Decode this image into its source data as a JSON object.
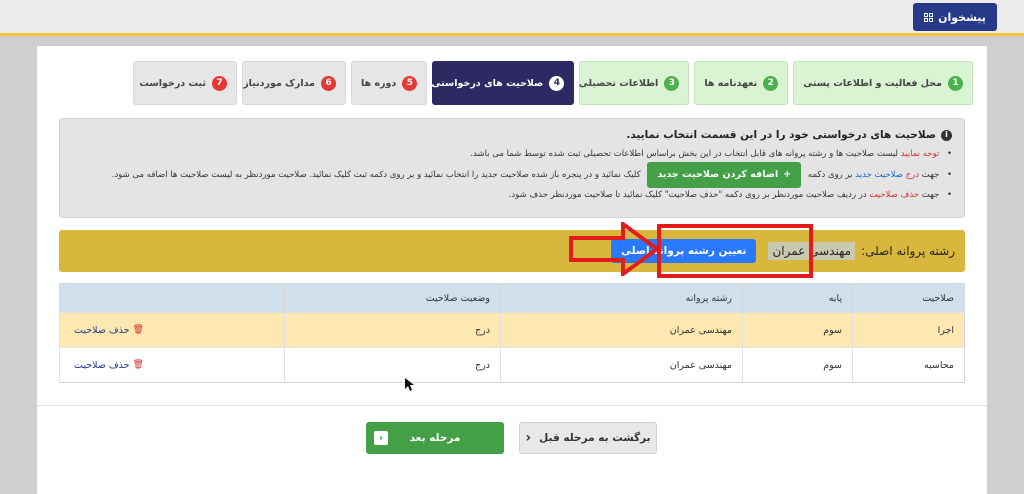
{
  "header": {
    "dashboard_label": "پیشخوان"
  },
  "steps": [
    {
      "num": "1",
      "label": "محل فعالیت و اطلاعات پستی",
      "state": "done"
    },
    {
      "num": "2",
      "label": "تعهدنامه ها",
      "state": "done"
    },
    {
      "num": "3",
      "label": "اطلاعات تحصیلی",
      "state": "done"
    },
    {
      "num": "4",
      "label": "صلاحیت های درخواستی",
      "state": "active"
    },
    {
      "num": "5",
      "label": "دوره ها",
      "state": "todo"
    },
    {
      "num": "6",
      "label": "مدارک موردنیاز",
      "state": "todo"
    },
    {
      "num": "7",
      "label": "ثبت درخواست",
      "state": "todo"
    }
  ],
  "info": {
    "heading": "صلاحیت های درخواستی خود را در این قسمت انتخاب نمایید.",
    "note1_prefix": "توجه نمایید",
    "note1_text": "لیست صلاحیت ها و رشته پروانه های قابل انتخاب در این بخش براساس اطلاعات تحصیلی ثبت شده توسط شما می باشد.",
    "note2_a": "جهت",
    "note2_red": "درج",
    "note2_blue": "صلاحیت جدید",
    "note2_b": "بر روی دکمه",
    "note2_c": "کلیک نمائید و در پنجره باز شده صلاحیت جدید را انتخاب نمائید و بر روی دکمه ثبت کلیک نمائید. صلاحیت موردنظر به لیست صلاحیت ها اضافه می شود.",
    "add_button": "اضافه کردن صلاحیت جدید",
    "note3_a": "جهت",
    "note3_red": "حذف صلاحیت",
    "note3_b": "در ردیف صلاحیت موردنظر بر روی دکمه \"حذف صلاحیت\" کلیک نمائید تا صلاحیت موردنظر حذف شود."
  },
  "main_major": {
    "label": "رشته پروانه اصلی:",
    "value": "مهندسی عمران",
    "button": "تعیین رشته پروانه اصلی"
  },
  "table": {
    "headers": [
      "صلاحیت",
      "پایه",
      "رشته پروانه",
      "وضعیت صلاحیت",
      ""
    ],
    "rows": [
      {
        "competency": "اجرا",
        "grade": "سوم",
        "field": "مهندسی عمران",
        "status": "درج",
        "action": "حذف صلاحیت"
      },
      {
        "competency": "محاسبه",
        "grade": "سوم",
        "field": "مهندسی عمران",
        "status": "درج",
        "action": "حذف صلاحیت"
      }
    ]
  },
  "footer": {
    "next_label": "مرحله بعد",
    "back_label": "برگشت به مرحله قبل"
  },
  "colors": {
    "navy": "#2d2a63",
    "green": "#43a047",
    "gold": "#d8b73c",
    "blue": "#2979ff",
    "red": "#e41b1b"
  }
}
